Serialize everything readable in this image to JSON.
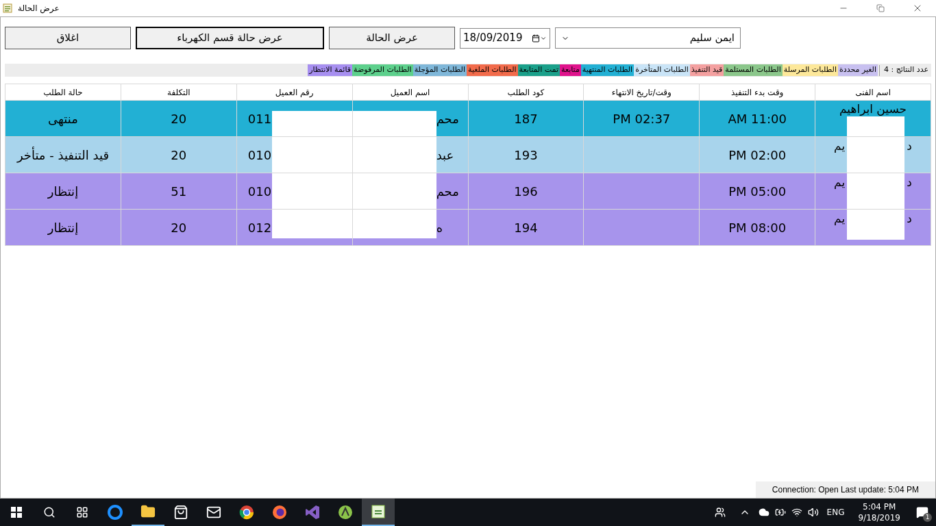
{
  "window": {
    "title": "عرض الحالة"
  },
  "toolbar": {
    "technician": "ايمن سليم",
    "date": "18/09/2019",
    "buttons": [
      {
        "label": "عرض الحالة",
        "emphasized": false
      },
      {
        "label": "عرض حالة قسم الكهرباء",
        "emphasized": true
      },
      {
        "label": "اغلاق",
        "emphasized": false
      }
    ]
  },
  "legend": {
    "count_label": "عدد النتائج :",
    "count": "4",
    "items": [
      {
        "label": "الغير محددة",
        "color": "#c8c0f0"
      },
      {
        "label": "الطلبات المرسلة",
        "color": "#fde89a"
      },
      {
        "label": "الطلبات المستلمة",
        "color": "#8bc78b"
      },
      {
        "label": "قيد التنفيذ",
        "color": "#f4a0a0"
      },
      {
        "label": "الطلبات المتأخرة",
        "color": "#c9e4f7"
      },
      {
        "label": "الطلبات المنتهية",
        "color": "#22b0d4"
      },
      {
        "label": "متابعة",
        "color": "#e0138c"
      },
      {
        "label": "تمت المتابعة",
        "color": "#1aa08a"
      },
      {
        "label": "الطلبات الملغية",
        "color": "#f26b4b"
      },
      {
        "label": "الطلبات المؤجلة",
        "color": "#7fb7d9"
      },
      {
        "label": "الطلبات المرفوضة",
        "color": "#5dd08c"
      },
      {
        "label": "قائمة الانتظار",
        "color": "#a78ff0"
      }
    ]
  },
  "table": {
    "columns": [
      "اسم الفنى",
      "وقت بدء التنفيذ",
      "وقت/تاريخ الانتهاء",
      "كود الطلب",
      "اسم العميل",
      "رقم العميل",
      "التكلفة",
      "حالة الطلب"
    ],
    "rows": [
      {
        "color": "#22b0d4",
        "technician": [
          "حسين ابراهيم"
        ],
        "start": "AM 11:00",
        "end": "PM 02:37",
        "code": "187",
        "client": "محم",
        "phone": "011",
        "cost": "20",
        "status": "منتهى"
      },
      {
        "color": "#a8d4ec",
        "technician": [
          "د",
          "يم"
        ],
        "start": "PM 02:00",
        "end": "",
        "code": "193",
        "client": "عبد",
        "phone": "010",
        "cost": "20",
        "status": "قيد التنفيذ - متأخر"
      },
      {
        "color": "#a794ec",
        "technician": [
          "د",
          "يم"
        ],
        "start": "PM 05:00",
        "end": "",
        "code": "196",
        "client": "محم",
        "phone": "010",
        "cost": "51",
        "status": "إنتظار"
      },
      {
        "color": "#a794ec",
        "technician": [
          "د",
          "يم"
        ],
        "start": "PM 08:00",
        "end": "",
        "code": "194",
        "client": "ه",
        "phone": "012",
        "cost": "20",
        "status": "إنتظار"
      }
    ]
  },
  "status_bar": "Connection: Open Last update: 5:04 PM",
  "taskbar": {
    "language": "ENG",
    "time": "5:04 PM",
    "date": "9/18/2019",
    "notifications": "1"
  }
}
